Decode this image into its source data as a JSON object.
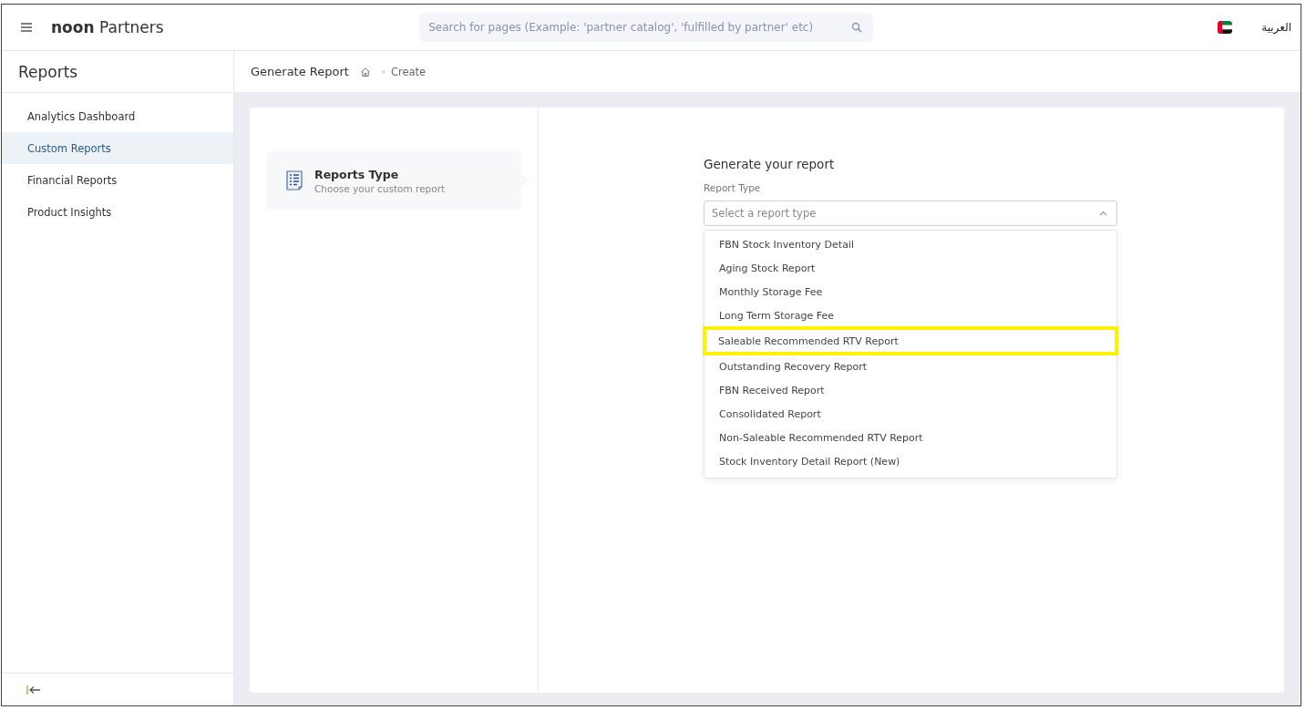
{
  "header": {
    "brand_bold": "noon",
    "brand_rest": "Partners",
    "search": {
      "placeholder": "Search for pages (Example: 'partner catalog', 'fulfilled by partner' etc)"
    },
    "language": "العربية"
  },
  "sidebar": {
    "title": "Reports",
    "items": [
      {
        "label": "Analytics Dashboard",
        "selected": false
      },
      {
        "label": "Custom Reports",
        "selected": true
      },
      {
        "label": "Financial Reports",
        "selected": false
      },
      {
        "label": "Product Insights",
        "selected": false
      }
    ]
  },
  "breadcrumb": {
    "title": "Generate Report",
    "current": "Create"
  },
  "step": {
    "title": "Reports Type",
    "subtitle": "Choose your custom report"
  },
  "form": {
    "heading": "Generate your report",
    "field_label": "Report Type",
    "select": {
      "placeholder": "Select a report type",
      "expanded": true
    },
    "options": [
      {
        "label": "FBN Stock Inventory Detail",
        "highlighted": false
      },
      {
        "label": "Aging Stock Report",
        "highlighted": false
      },
      {
        "label": "Monthly Storage Fee",
        "highlighted": false
      },
      {
        "label": "Long Term Storage Fee",
        "highlighted": false
      },
      {
        "label": "Saleable Recommended RTV Report",
        "highlighted": true
      },
      {
        "label": "Outstanding Recovery Report",
        "highlighted": false
      },
      {
        "label": "FBN Received Report",
        "highlighted": false
      },
      {
        "label": "Consolidated Report",
        "highlighted": false
      },
      {
        "label": "Non-Saleable Recommended RTV Report",
        "highlighted": false
      },
      {
        "label": "Stock Inventory Detail Report (New)",
        "highlighted": false
      }
    ]
  }
}
